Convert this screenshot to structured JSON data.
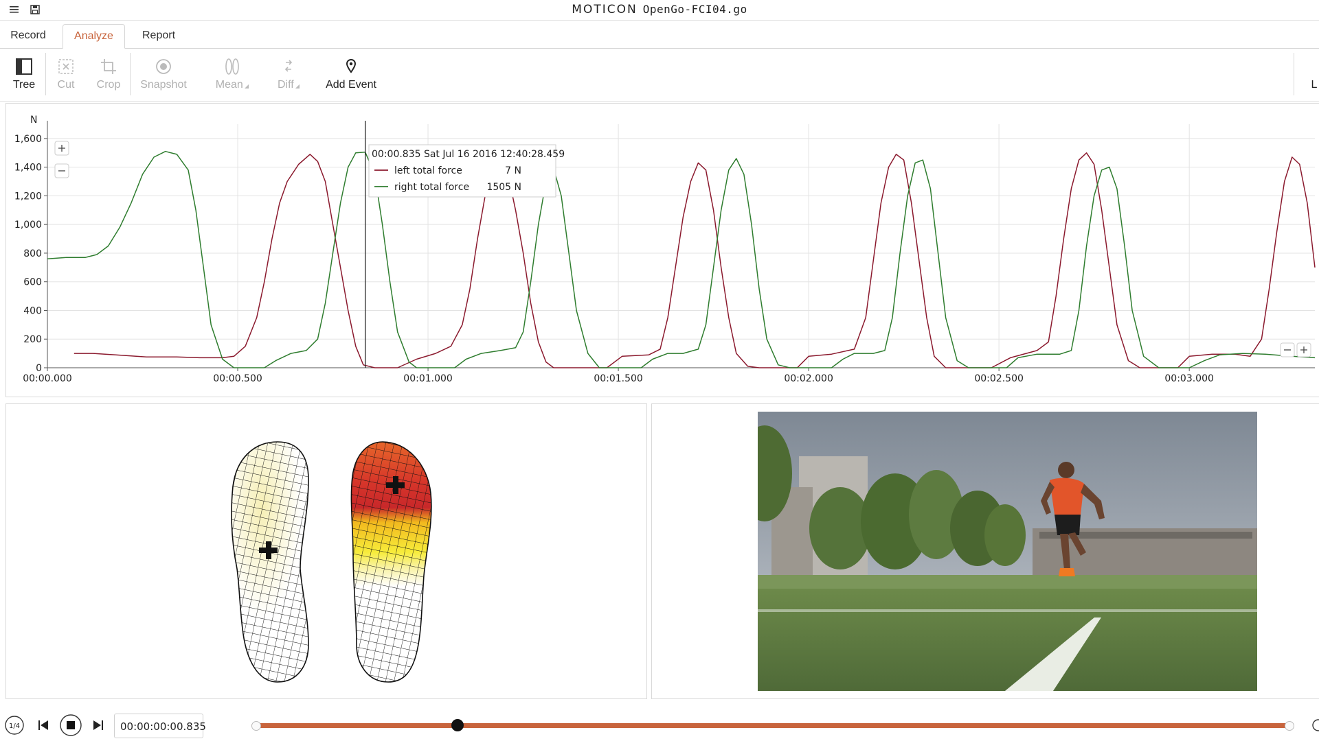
{
  "window": {
    "brand": "MOTICON",
    "filename": "OpenGo-FCI04.go"
  },
  "tabs": [
    {
      "label": "Record",
      "active": false
    },
    {
      "label": "Analyze",
      "active": true
    },
    {
      "label": "Report",
      "active": false
    }
  ],
  "toolbar": {
    "tree": "Tree",
    "cut": "Cut",
    "crop": "Crop",
    "snapshot": "Snapshot",
    "mean": "Mean",
    "diff": "Diff",
    "add_event": "Add Event",
    "right_partial": "L"
  },
  "colors": {
    "accent": "#c8643c",
    "left_series": "#8b1a2e",
    "right_series": "#2f7d2f"
  },
  "chart_data": {
    "type": "line",
    "ylabel": "N",
    "ylim": [
      0,
      1700
    ],
    "yticks": [
      "0",
      "200",
      "400",
      "600",
      "800",
      "1,000",
      "1,200",
      "1,400",
      "1,600"
    ],
    "xticks": [
      "00:00.000",
      "00:00.500",
      "00:01.000",
      "00:01.500",
      "00:02.000",
      "00:02.500",
      "00:03.000"
    ],
    "xlim": [
      0,
      3.33
    ],
    "grid": true,
    "cursor_time": 0.835,
    "tooltip": {
      "header": "00:00.835 Sat Jul 16 2016 12:40:28.459",
      "rows": [
        {
          "series": "left total force",
          "value": "7 N"
        },
        {
          "series": "right total force",
          "value": "1505 N"
        }
      ]
    },
    "series": [
      {
        "name": "left total force",
        "points": [
          [
            0.07,
            100
          ],
          [
            0.12,
            100
          ],
          [
            0.18,
            90
          ],
          [
            0.26,
            75
          ],
          [
            0.34,
            75
          ],
          [
            0.4,
            70
          ],
          [
            0.46,
            70
          ],
          [
            0.49,
            80
          ],
          [
            0.52,
            150
          ],
          [
            0.55,
            350
          ],
          [
            0.57,
            600
          ],
          [
            0.59,
            900
          ],
          [
            0.61,
            1150
          ],
          [
            0.63,
            1300
          ],
          [
            0.66,
            1420
          ],
          [
            0.69,
            1490
          ],
          [
            0.71,
            1440
          ],
          [
            0.73,
            1300
          ],
          [
            0.75,
            1000
          ],
          [
            0.77,
            700
          ],
          [
            0.79,
            400
          ],
          [
            0.81,
            150
          ],
          [
            0.83,
            20
          ],
          [
            0.86,
            0
          ],
          [
            0.92,
            0
          ],
          [
            0.97,
            60
          ],
          [
            1.02,
            100
          ],
          [
            1.06,
            150
          ],
          [
            1.09,
            300
          ],
          [
            1.11,
            550
          ],
          [
            1.13,
            900
          ],
          [
            1.15,
            1200
          ],
          [
            1.17,
            1380
          ],
          [
            1.19,
            1440
          ],
          [
            1.21,
            1350
          ],
          [
            1.23,
            1100
          ],
          [
            1.25,
            800
          ],
          [
            1.27,
            450
          ],
          [
            1.29,
            180
          ],
          [
            1.31,
            40
          ],
          [
            1.33,
            0
          ],
          [
            1.47,
            0
          ],
          [
            1.51,
            80
          ],
          [
            1.58,
            90
          ],
          [
            1.61,
            130
          ],
          [
            1.63,
            350
          ],
          [
            1.65,
            700
          ],
          [
            1.67,
            1050
          ],
          [
            1.69,
            1300
          ],
          [
            1.71,
            1430
          ],
          [
            1.73,
            1380
          ],
          [
            1.75,
            1100
          ],
          [
            1.77,
            700
          ],
          [
            1.79,
            350
          ],
          [
            1.81,
            100
          ],
          [
            1.84,
            10
          ],
          [
            1.87,
            0
          ],
          [
            1.97,
            0
          ],
          [
            2.0,
            80
          ],
          [
            2.06,
            95
          ],
          [
            2.12,
            130
          ],
          [
            2.15,
            350
          ],
          [
            2.17,
            750
          ],
          [
            2.19,
            1150
          ],
          [
            2.21,
            1400
          ],
          [
            2.23,
            1490
          ],
          [
            2.25,
            1450
          ],
          [
            2.27,
            1150
          ],
          [
            2.29,
            750
          ],
          [
            2.31,
            350
          ],
          [
            2.33,
            80
          ],
          [
            2.36,
            0
          ],
          [
            2.48,
            0
          ],
          [
            2.53,
            70
          ],
          [
            2.6,
            120
          ],
          [
            2.63,
            180
          ],
          [
            2.65,
            500
          ],
          [
            2.67,
            900
          ],
          [
            2.69,
            1250
          ],
          [
            2.71,
            1450
          ],
          [
            2.73,
            1500
          ],
          [
            2.75,
            1420
          ],
          [
            2.77,
            1100
          ],
          [
            2.79,
            700
          ],
          [
            2.81,
            300
          ],
          [
            2.84,
            50
          ],
          [
            2.87,
            0
          ],
          [
            2.97,
            0
          ],
          [
            3.0,
            80
          ],
          [
            3.06,
            95
          ],
          [
            3.12,
            95
          ],
          [
            3.16,
            80
          ],
          [
            3.19,
            200
          ],
          [
            3.21,
            550
          ],
          [
            3.23,
            950
          ],
          [
            3.25,
            1300
          ],
          [
            3.27,
            1470
          ],
          [
            3.29,
            1420
          ],
          [
            3.31,
            1150
          ],
          [
            3.33,
            700
          ]
        ]
      },
      {
        "name": "right total force",
        "points": [
          [
            0.0,
            760
          ],
          [
            0.05,
            770
          ],
          [
            0.1,
            770
          ],
          [
            0.13,
            790
          ],
          [
            0.16,
            850
          ],
          [
            0.19,
            980
          ],
          [
            0.22,
            1150
          ],
          [
            0.25,
            1350
          ],
          [
            0.28,
            1470
          ],
          [
            0.31,
            1510
          ],
          [
            0.34,
            1490
          ],
          [
            0.37,
            1380
          ],
          [
            0.39,
            1100
          ],
          [
            0.41,
            700
          ],
          [
            0.43,
            300
          ],
          [
            0.46,
            60
          ],
          [
            0.49,
            0
          ],
          [
            0.57,
            0
          ],
          [
            0.6,
            50
          ],
          [
            0.64,
            100
          ],
          [
            0.68,
            120
          ],
          [
            0.71,
            200
          ],
          [
            0.73,
            450
          ],
          [
            0.75,
            800
          ],
          [
            0.77,
            1150
          ],
          [
            0.79,
            1400
          ],
          [
            0.81,
            1500
          ],
          [
            0.835,
            1505
          ],
          [
            0.86,
            1350
          ],
          [
            0.88,
            1000
          ],
          [
            0.9,
            600
          ],
          [
            0.92,
            250
          ],
          [
            0.95,
            40
          ],
          [
            0.97,
            0
          ],
          [
            1.07,
            0
          ],
          [
            1.1,
            60
          ],
          [
            1.14,
            100
          ],
          [
            1.19,
            120
          ],
          [
            1.23,
            140
          ],
          [
            1.25,
            250
          ],
          [
            1.27,
            600
          ],
          [
            1.29,
            1000
          ],
          [
            1.31,
            1300
          ],
          [
            1.33,
            1390
          ],
          [
            1.35,
            1200
          ],
          [
            1.37,
            800
          ],
          [
            1.39,
            400
          ],
          [
            1.42,
            100
          ],
          [
            1.45,
            0
          ],
          [
            1.56,
            0
          ],
          [
            1.59,
            60
          ],
          [
            1.63,
            100
          ],
          [
            1.67,
            100
          ],
          [
            1.71,
            130
          ],
          [
            1.73,
            300
          ],
          [
            1.75,
            700
          ],
          [
            1.77,
            1100
          ],
          [
            1.79,
            1380
          ],
          [
            1.81,
            1460
          ],
          [
            1.83,
            1350
          ],
          [
            1.85,
            1000
          ],
          [
            1.87,
            550
          ],
          [
            1.89,
            200
          ],
          [
            1.92,
            20
          ],
          [
            1.95,
            0
          ],
          [
            2.06,
            0
          ],
          [
            2.09,
            60
          ],
          [
            2.12,
            100
          ],
          [
            2.17,
            100
          ],
          [
            2.2,
            120
          ],
          [
            2.22,
            350
          ],
          [
            2.24,
            800
          ],
          [
            2.26,
            1200
          ],
          [
            2.28,
            1430
          ],
          [
            2.3,
            1450
          ],
          [
            2.32,
            1250
          ],
          [
            2.34,
            800
          ],
          [
            2.36,
            350
          ],
          [
            2.39,
            50
          ],
          [
            2.42,
            0
          ],
          [
            2.52,
            0
          ],
          [
            2.55,
            70
          ],
          [
            2.6,
            95
          ],
          [
            2.66,
            95
          ],
          [
            2.69,
            120
          ],
          [
            2.71,
            400
          ],
          [
            2.73,
            850
          ],
          [
            2.75,
            1200
          ],
          [
            2.77,
            1380
          ],
          [
            2.79,
            1400
          ],
          [
            2.81,
            1250
          ],
          [
            2.83,
            850
          ],
          [
            2.85,
            400
          ],
          [
            2.88,
            80
          ],
          [
            2.92,
            0
          ],
          [
            3.0,
            0
          ],
          [
            3.04,
            50
          ],
          [
            3.08,
            90
          ],
          [
            3.14,
            100
          ],
          [
            3.2,
            95
          ],
          [
            3.27,
            80
          ],
          [
            3.33,
            70
          ]
        ]
      }
    ]
  },
  "playback": {
    "speed": "1/4",
    "current_time": "00:00:00:00.835",
    "progress": 0.198
  }
}
